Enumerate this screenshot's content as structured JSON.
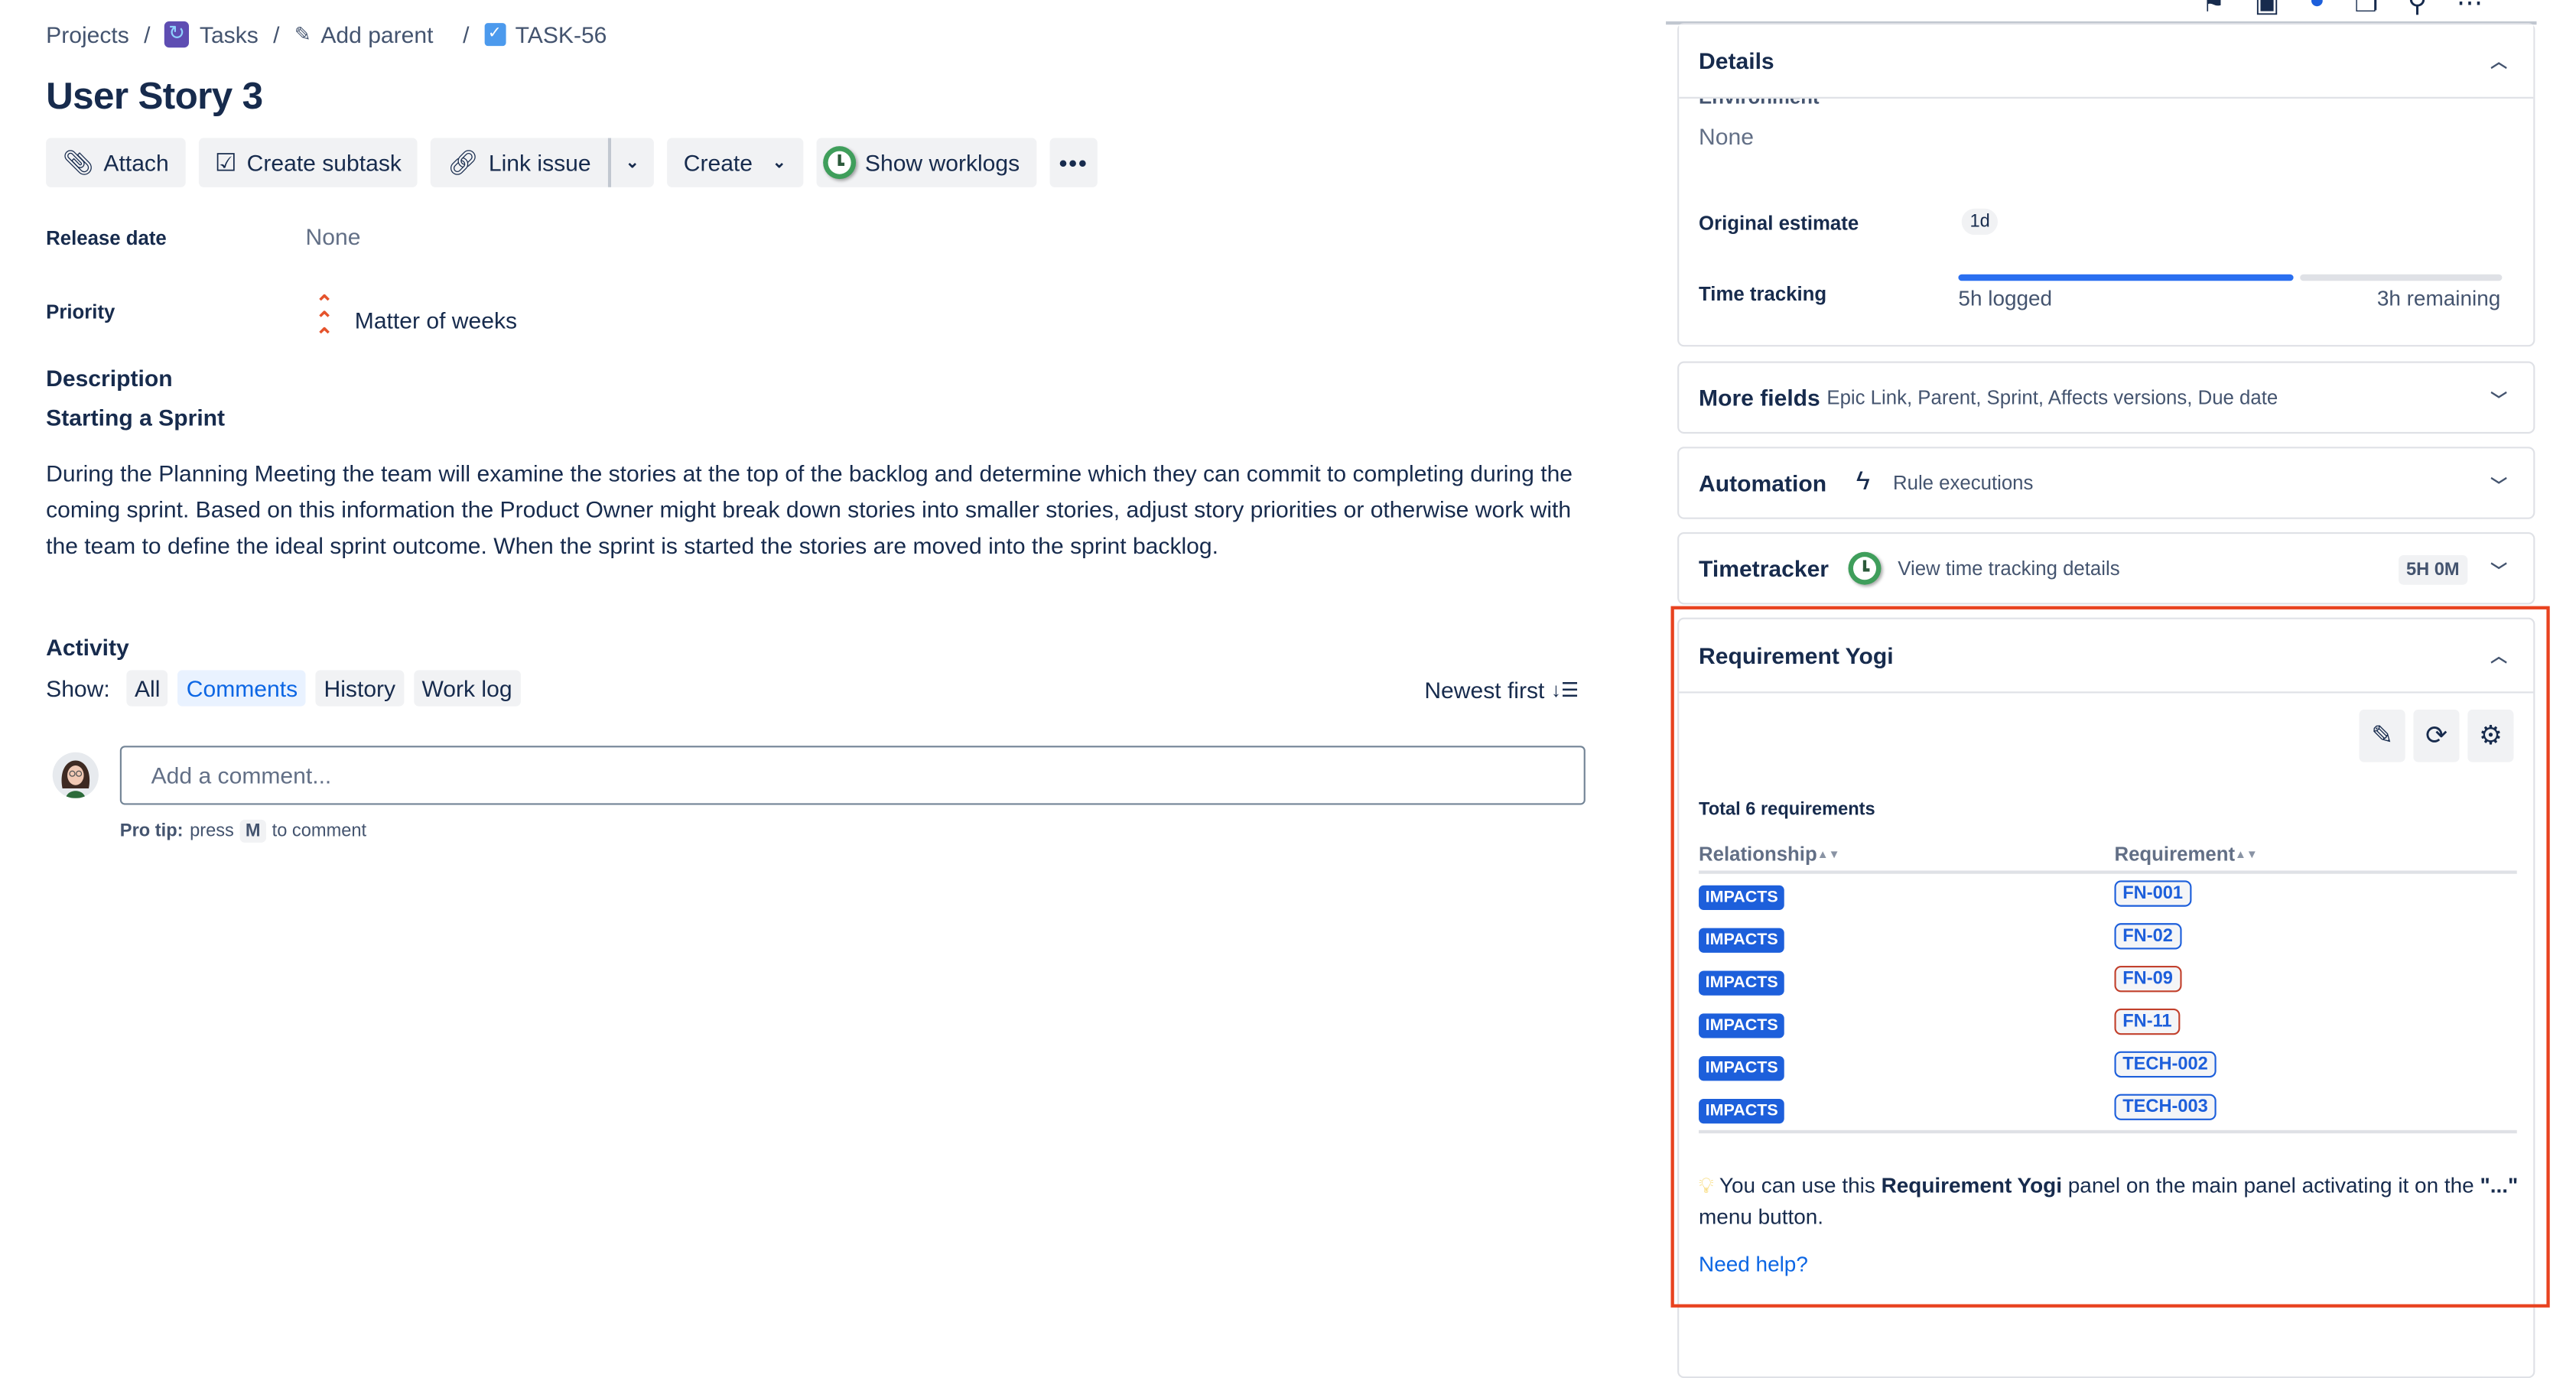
{
  "breadcrumb": {
    "items": [
      "Projects",
      "Tasks",
      "Add parent",
      "TASK-56"
    ],
    "separator": "/"
  },
  "issue": {
    "title": "User Story 3"
  },
  "toolbar": {
    "attach": "Attach",
    "create_subtask": "Create subtask",
    "link_issue": "Link issue",
    "create": "Create",
    "show_worklogs": "Show worklogs",
    "more": "•••"
  },
  "fields": {
    "release_date": {
      "label": "Release date",
      "value": "None"
    },
    "priority": {
      "label": "Priority",
      "value": "Matter of weeks"
    }
  },
  "description": {
    "heading": "Description",
    "subheading": "Starting a Sprint",
    "body": "During the Planning Meeting the team will examine the stories at the top of the backlog and determine which they can commit to completing during the coming sprint. Based on this information the Product Owner might break down stories into smaller stories, adjust story priorities or otherwise work with the team to define the ideal sprint outcome. When the sprint is started the stories are moved into the sprint backlog."
  },
  "activity": {
    "heading": "Activity",
    "show_label": "Show:",
    "filters": [
      "All",
      "Comments",
      "History",
      "Work log"
    ],
    "active_filter": "Comments",
    "sort_label": "Newest first",
    "comment_placeholder": "Add a comment...",
    "protip_prefix": "Pro tip:",
    "protip_press": "press",
    "protip_key": "M",
    "protip_suffix": "to comment"
  },
  "details": {
    "header": "Details",
    "environment_label": "Environment",
    "environment_value": "None",
    "original_estimate_label": "Original estimate",
    "original_estimate_value": "1d",
    "time_tracking_label": "Time tracking",
    "time_logged": "5h logged",
    "time_remaining": "3h remaining",
    "logged_fraction": 0.625
  },
  "more_fields": {
    "header": "More fields",
    "summary": "Epic Link, Parent, Sprint, Affects versions, Due date"
  },
  "automation": {
    "header": "Automation",
    "summary": "Rule executions"
  },
  "timetracker": {
    "header": "Timetracker",
    "summary": "View time tracking details",
    "badge": "5H 0M"
  },
  "requirement_yogi": {
    "header": "Requirement Yogi",
    "total": "Total 6 requirements",
    "columns": [
      "Relationship",
      "Requirement"
    ],
    "rows": [
      {
        "relationship": "IMPACTS",
        "requirement": "FN-001",
        "status": "ok"
      },
      {
        "relationship": "IMPACTS",
        "requirement": "FN-02",
        "status": "ok"
      },
      {
        "relationship": "IMPACTS",
        "requirement": "FN-09",
        "status": "warning"
      },
      {
        "relationship": "IMPACTS",
        "requirement": "FN-11",
        "status": "warning"
      },
      {
        "relationship": "IMPACTS",
        "requirement": "TECH-002",
        "status": "ok"
      },
      {
        "relationship": "IMPACTS",
        "requirement": "TECH-003",
        "status": "ok"
      }
    ],
    "tip_prefix": "You can use this",
    "tip_bold": "Requirement Yogi",
    "tip_middle": "panel on the main panel activating it on the",
    "tip_quote": "\"...\"",
    "tip_suffix": "menu button.",
    "help_link": "Need help?"
  },
  "colors": {
    "accent": "#0c66e4",
    "badge_blue": "#1d5fdb",
    "warning_border": "#c2412d",
    "highlight": "#e8421f",
    "progress": "#2a6ff0"
  }
}
